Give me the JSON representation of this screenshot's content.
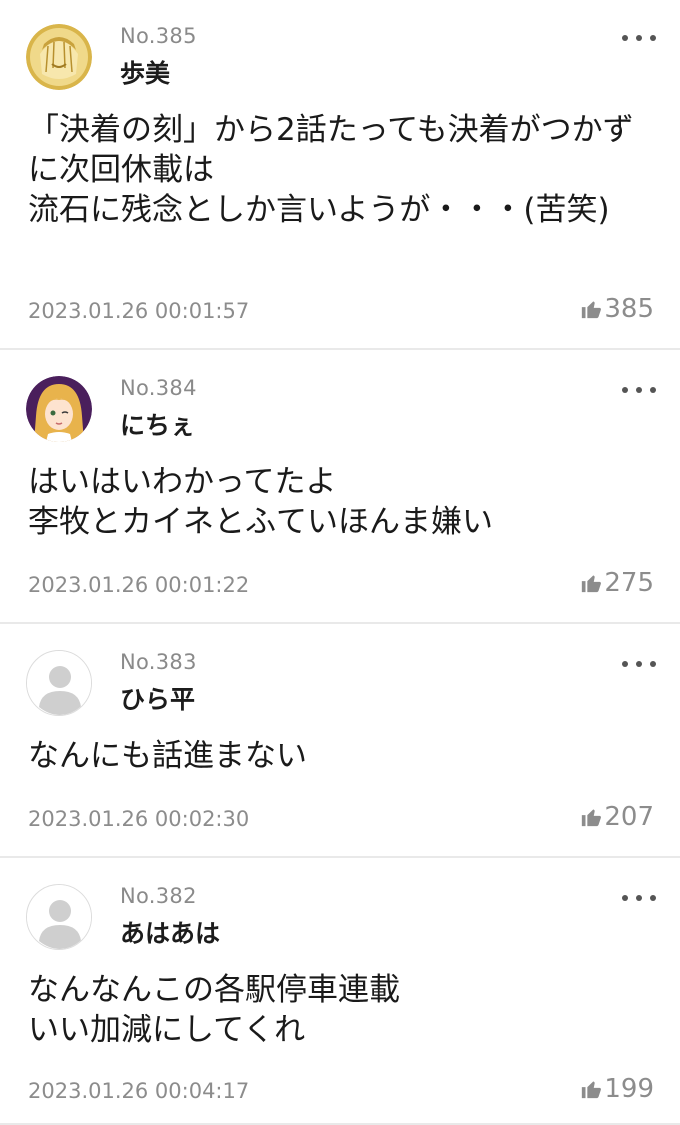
{
  "comments": [
    {
      "no": "No.385",
      "name": "歩美",
      "body": "「決着の刻」から2話たっても決着がつかずに次回休載は\n流石に残念としか言いようが・・・(苦笑)",
      "time": "2023.01.26 00:01:57",
      "likes": "385",
      "avatar": "anime-gold-icon"
    },
    {
      "no": "No.384",
      "name": "にちぇ",
      "body": "はいはいわかってたよ\n李牧とカイネとふていほんま嫌い",
      "time": "2023.01.26 00:01:22",
      "likes": "275",
      "avatar": "anime-girl-icon"
    },
    {
      "no": "No.383",
      "name": "ひら平",
      "body": "なんにも話進まない",
      "time": "2023.01.26 00:02:30",
      "likes": "207",
      "avatar": "default-user-icon"
    },
    {
      "no": "No.382",
      "name": "あはあは",
      "body": "なんなんこの各駅停車連載\nいい加減にしてくれ",
      "time": "2023.01.26 00:04:17",
      "likes": "199",
      "avatar": "default-user-icon"
    }
  ],
  "colors": {
    "meta": "#8c8c8c",
    "divider": "#e9e9e9",
    "text": "#1a1a1a"
  }
}
